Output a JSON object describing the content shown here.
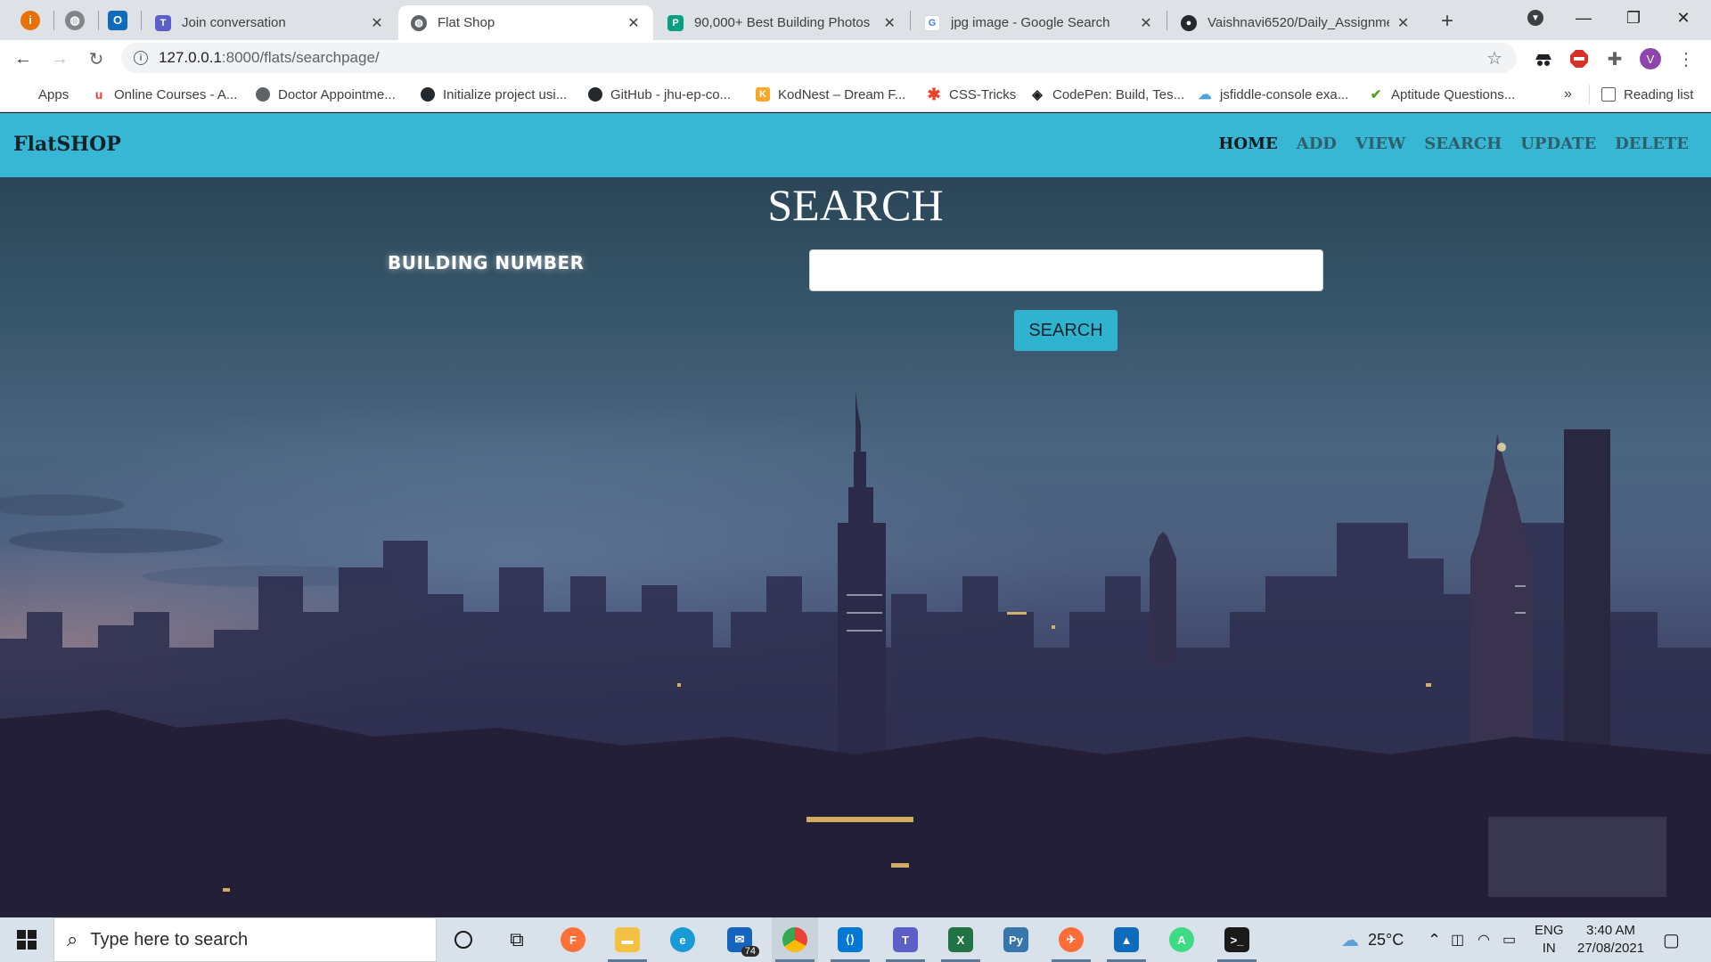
{
  "browser": {
    "tabs": [
      {
        "title": "Join conversation",
        "icon": "teams-icon",
        "color": "#5b5fc7"
      },
      {
        "title": "Flat Shop",
        "icon": "globe-icon",
        "color": "#5f6368",
        "active": true
      },
      {
        "title": "90,000+ Best Building Photos ·",
        "icon": "pexels-icon",
        "color": "#05a081"
      },
      {
        "title": "jpg image - Google Search",
        "icon": "google-icon",
        "color": "#4285f4"
      },
      {
        "title": "Vaishnavi6520/Daily_Assignmen",
        "icon": "github-icon",
        "color": "#24292e"
      }
    ],
    "new_tab": "+",
    "url_host": "127.0.0.1",
    "url_path": ":8000/flats/searchpage/",
    "profile_initial": "V",
    "bookmarks": [
      {
        "label": "Apps",
        "icon": "apps-grid-icon",
        "color": "#4285f4"
      },
      {
        "label": "Online Courses - A...",
        "icon": "udemy-icon",
        "color": "#a435f0"
      },
      {
        "label": "Doctor Appointme...",
        "icon": "globe-icon",
        "color": "#5f6368"
      },
      {
        "label": "Initialize project usi...",
        "icon": "github-icon",
        "color": "#24292e"
      },
      {
        "label": "GitHub - jhu-ep-co...",
        "icon": "github-icon",
        "color": "#24292e"
      },
      {
        "label": "KodNest – Dream F...",
        "icon": "kodnest-icon",
        "color": "#f6a928"
      },
      {
        "label": "CSS-Tricks",
        "icon": "css-tricks-icon",
        "color": "#e8452b"
      },
      {
        "label": "CodePen: Build, Tes...",
        "icon": "codepen-icon",
        "color": "#1b1b1b"
      },
      {
        "label": "jsfiddle-console exa...",
        "icon": "jsfiddle-icon",
        "color": "#4aa3df"
      },
      {
        "label": "Aptitude Questions...",
        "icon": "indiabix-icon",
        "color": "#5a9e2a"
      }
    ],
    "bookmarks_overflow": "»",
    "reading_list": "Reading list"
  },
  "site": {
    "brand": "FlatSHOP",
    "menu": [
      "HOME",
      "ADD",
      "VIEW",
      "SEARCH",
      "UPDATE",
      "DELETE"
    ],
    "heading": "SEARCH",
    "field_label": "BUILDING NUMBER",
    "input_value": "",
    "button_label": "SEARCH",
    "nav_color": "#37b7d3"
  },
  "taskbar": {
    "search_placeholder": "Type here to search",
    "mail_badge": "74",
    "temperature": "25°C",
    "language_line1": "ENG",
    "language_line2": "IN",
    "time": "3:40 AM",
    "date": "27/08/2021"
  }
}
